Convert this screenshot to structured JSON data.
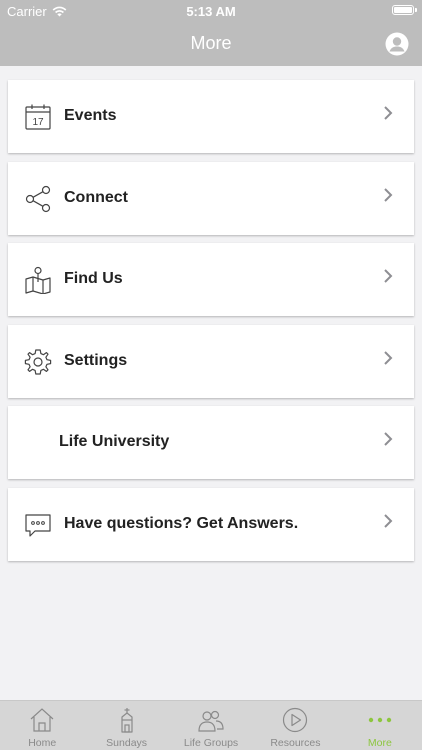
{
  "status_bar": {
    "carrier": "Carrier",
    "time": "5:13 AM"
  },
  "nav": {
    "title": "More"
  },
  "menu": [
    {
      "label": "Events",
      "icon": "calendar-icon",
      "day": "17"
    },
    {
      "label": "Connect",
      "icon": "share-icon"
    },
    {
      "label": "Find Us",
      "icon": "map-pin-icon"
    },
    {
      "label": "Settings",
      "icon": "gear-icon"
    },
    {
      "label": "Life University",
      "icon": ""
    },
    {
      "label": "Have questions? Get Answers.",
      "icon": "chat-bubble-icon"
    }
  ],
  "tabs": [
    {
      "label": "Home",
      "icon": "house-icon"
    },
    {
      "label": "Sundays",
      "icon": "church-icon"
    },
    {
      "label": "Life Groups",
      "icon": "people-icon"
    },
    {
      "label": "Resources",
      "icon": "play-circle-icon"
    },
    {
      "label": "More",
      "icon": "more-dots-icon",
      "active": true
    }
  ],
  "colors": {
    "accent": "#8dc63f",
    "header": "#bdbdbd",
    "background": "#f2f2f4"
  }
}
